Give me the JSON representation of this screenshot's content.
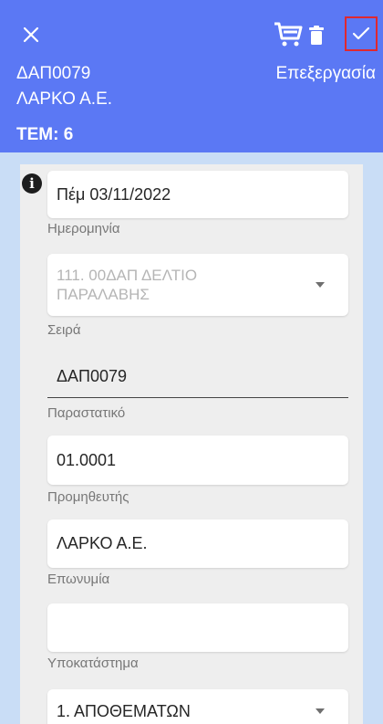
{
  "header": {
    "code": "ΔΑΠ0079",
    "name": "ΛΑΡΚΟ Α.Ε.",
    "mode": "Επεξεργασία",
    "tem": "ΤΕΜ: 6"
  },
  "form": {
    "date": {
      "value": "Πέμ 03/11/2022",
      "label": "Ημερομηνία"
    },
    "series": {
      "value": "111. 00ΔΑΠ ΔΕΛΤΙΟ ΠΑΡΑΛΑΒΗΣ",
      "label": "Σειρά"
    },
    "document": {
      "value": "ΔΑΠ0079",
      "label": "Παραστατικό"
    },
    "supplier": {
      "value": "01.0001",
      "label": "Προμηθευτής"
    },
    "company": {
      "value": "ΛΑΡΚΟ Α.Ε.",
      "label": "Επωνυμία"
    },
    "branch": {
      "value": "",
      "label": "Υποκατάστημα"
    },
    "warehouse": {
      "value": "1. ΑΠΟΘΕΜΑΤΩΝ"
    }
  },
  "colors": {
    "header": "#5b78f4",
    "background": "#c9ddf6",
    "highlight": "#e0282f"
  },
  "icons": [
    "close-icon",
    "cart-icon",
    "trash-icon",
    "check-icon",
    "info-icon",
    "chevron-down-icon"
  ]
}
